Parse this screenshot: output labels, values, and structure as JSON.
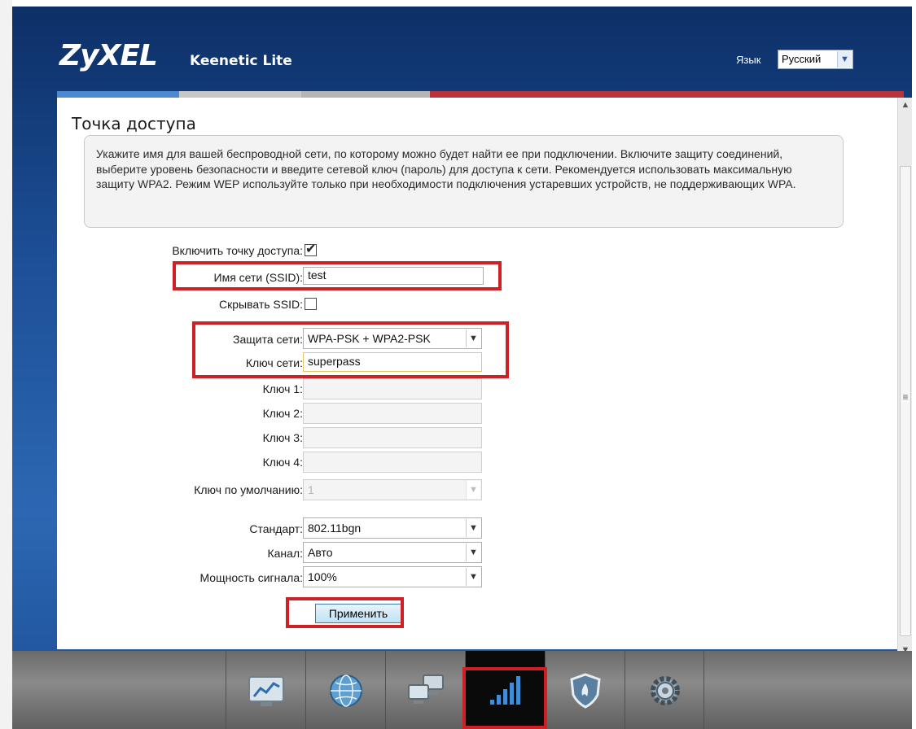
{
  "header": {
    "logo": "ZyXEL",
    "product": "Keenetic Lite",
    "language_label": "Язык",
    "language_value": "Русский"
  },
  "page": {
    "title": "Точка доступа",
    "info_text": "Укажите имя для вашей беспроводной сети, по которому можно будет найти ее при подключении. Включите защиту соединений, выберите уровень безопасности и введите сетевой ключ (пароль) для доступа к сети. Рекомендуется использовать максимальную защиту WPA2. Режим WEP используйте только при необходимости подключения устаревших устройств, не поддерживающих WPA."
  },
  "form": {
    "enable_ap_label": "Включить точку доступа:",
    "enable_ap_checked": true,
    "ssid_label": "Имя сети (SSID):",
    "ssid_value": "test",
    "hide_ssid_label": "Скрывать SSID:",
    "hide_ssid_checked": false,
    "security_label": "Защита сети:",
    "security_value": "WPA-PSK + WPA2-PSK",
    "network_key_label": "Ключ сети:",
    "network_key_value": "superpass",
    "key1_label": "Ключ 1:",
    "key2_label": "Ключ 2:",
    "key3_label": "Ключ 3:",
    "key4_label": "Ключ 4:",
    "default_key_label": "Ключ по умолчанию:",
    "default_key_value": "1",
    "standard_label": "Стандарт:",
    "standard_value": "802.11bgn",
    "channel_label": "Канал:",
    "channel_value": "Авто",
    "power_label": "Мощность сигнала:",
    "power_value": "100%",
    "apply_label": "Применить"
  },
  "dock": {
    "items": [
      {
        "icon": "monitor-chart-icon",
        "active": false
      },
      {
        "icon": "globe-icon",
        "active": false
      },
      {
        "icon": "network-computers-icon",
        "active": false
      },
      {
        "icon": "wifi-signal-bars-icon",
        "active": true
      },
      {
        "icon": "shield-icon",
        "active": false
      },
      {
        "icon": "gear-icon",
        "active": false
      }
    ]
  },
  "colors": {
    "header_blue": "#1c4f97",
    "accent_red": "#b9343a",
    "highlight_red": "#cf2025"
  }
}
